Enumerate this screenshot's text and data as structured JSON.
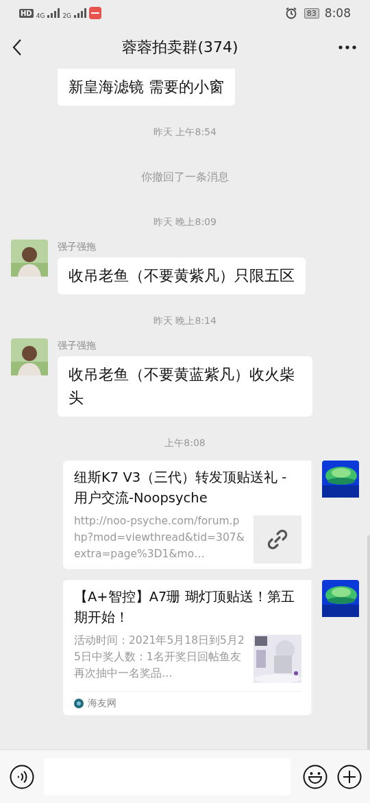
{
  "status_bar": {
    "hd": "HD",
    "network_1": "4G",
    "network_2": "2G",
    "battery": "83",
    "time": "8:08"
  },
  "header": {
    "title": "蓉蓉拍卖群(374)"
  },
  "messages": [
    {
      "kind": "fragment",
      "outgoing": false,
      "text": "新皇海滤镜 需要的小窗"
    },
    {
      "kind": "time",
      "text": "昨天 上午8:54"
    },
    {
      "kind": "system",
      "text": "你撤回了一条消息"
    },
    {
      "kind": "time",
      "text": "昨天 晚上8:09"
    },
    {
      "kind": "text",
      "outgoing": false,
      "sender": "强子强拖",
      "text": "收吊老鱼（不要黄紫凡）只限五区"
    },
    {
      "kind": "time",
      "text": "昨天 晚上8:14"
    },
    {
      "kind": "text",
      "outgoing": false,
      "sender": "强子强拖",
      "text": "收吊老鱼（不要黄蓝紫凡）收火柴头"
    },
    {
      "kind": "time",
      "text": "上午8:08"
    },
    {
      "kind": "link",
      "outgoing": true,
      "title": "纽斯K7 V3（三代）转发顶贴送礼 - 用户交流-Noopsyche",
      "description": "http://noo-psyche.com/forum.php?mod=viewthread&tid=307&extra=page%3D1&mo…",
      "thumbnail": {
        "kind": "link"
      }
    },
    {
      "kind": "link",
      "outgoing": true,
      "title": "【A+智控】A7珊 瑚灯顶贴送！第五期开始！",
      "description": "活动时间：2021年5月18日到5月25日中奖人数：1名开奖日回帖鱼友再次抽中一名奖品…",
      "source": "海友网"
    }
  ]
}
